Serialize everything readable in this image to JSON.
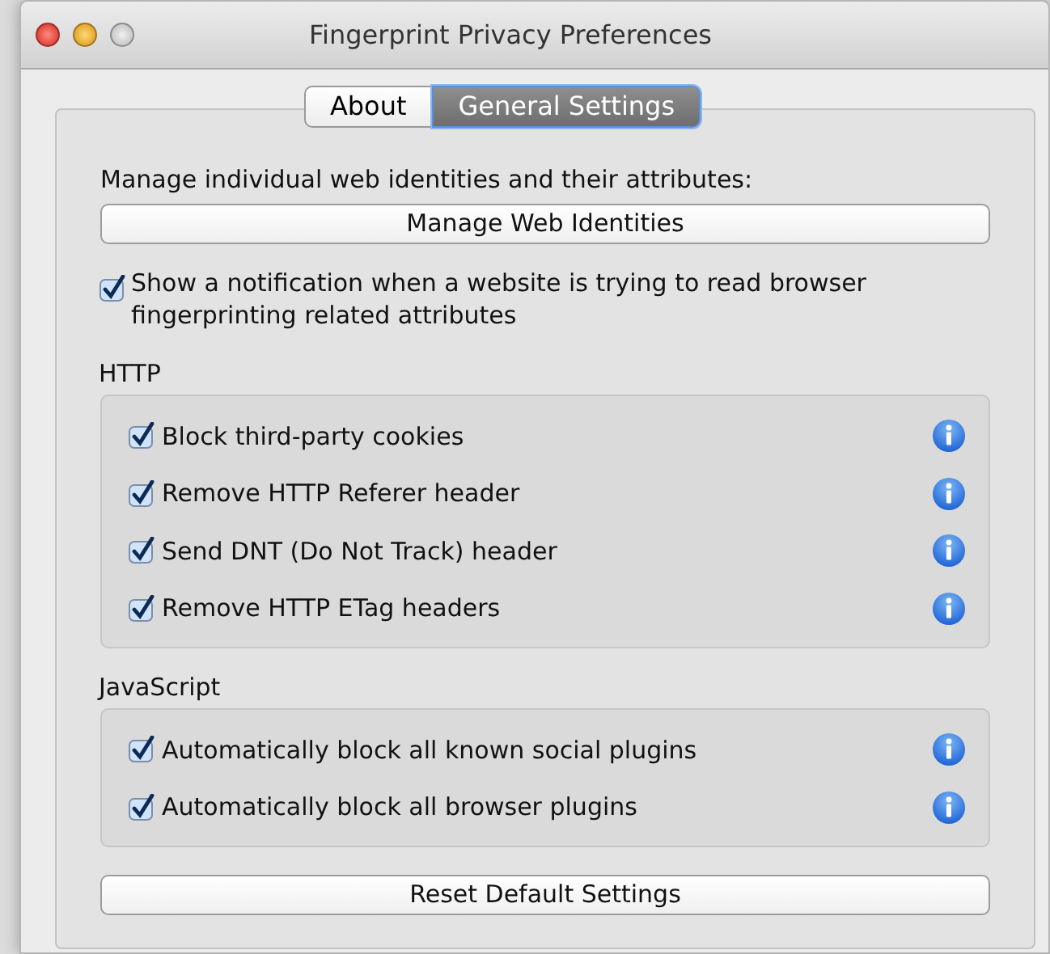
{
  "window": {
    "title": "Fingerprint Privacy Preferences"
  },
  "tabs": [
    {
      "label": "About",
      "selected": false
    },
    {
      "label": "General Settings",
      "selected": true
    }
  ],
  "intro": "Manage individual web identities and their attributes:",
  "manage_button": "Manage Web Identities",
  "notification": {
    "label": "Show a notification when a website is trying to read browser fingerprinting related attributes",
    "checked": true
  },
  "groups": [
    {
      "title": "HTTP",
      "options": [
        {
          "label": "Block third-party cookies",
          "checked": true
        },
        {
          "label": "Remove HTTP Referer header",
          "checked": true
        },
        {
          "label": "Send DNT (Do Not Track) header",
          "checked": true
        },
        {
          "label": "Remove HTTP ETag headers",
          "checked": true
        }
      ]
    },
    {
      "title": "JavaScript",
      "options": [
        {
          "label": "Automatically block all known social plugins",
          "checked": true
        },
        {
          "label": "Automatically block all browser plugins",
          "checked": true
        }
      ]
    }
  ],
  "reset_button": "Reset Default Settings"
}
